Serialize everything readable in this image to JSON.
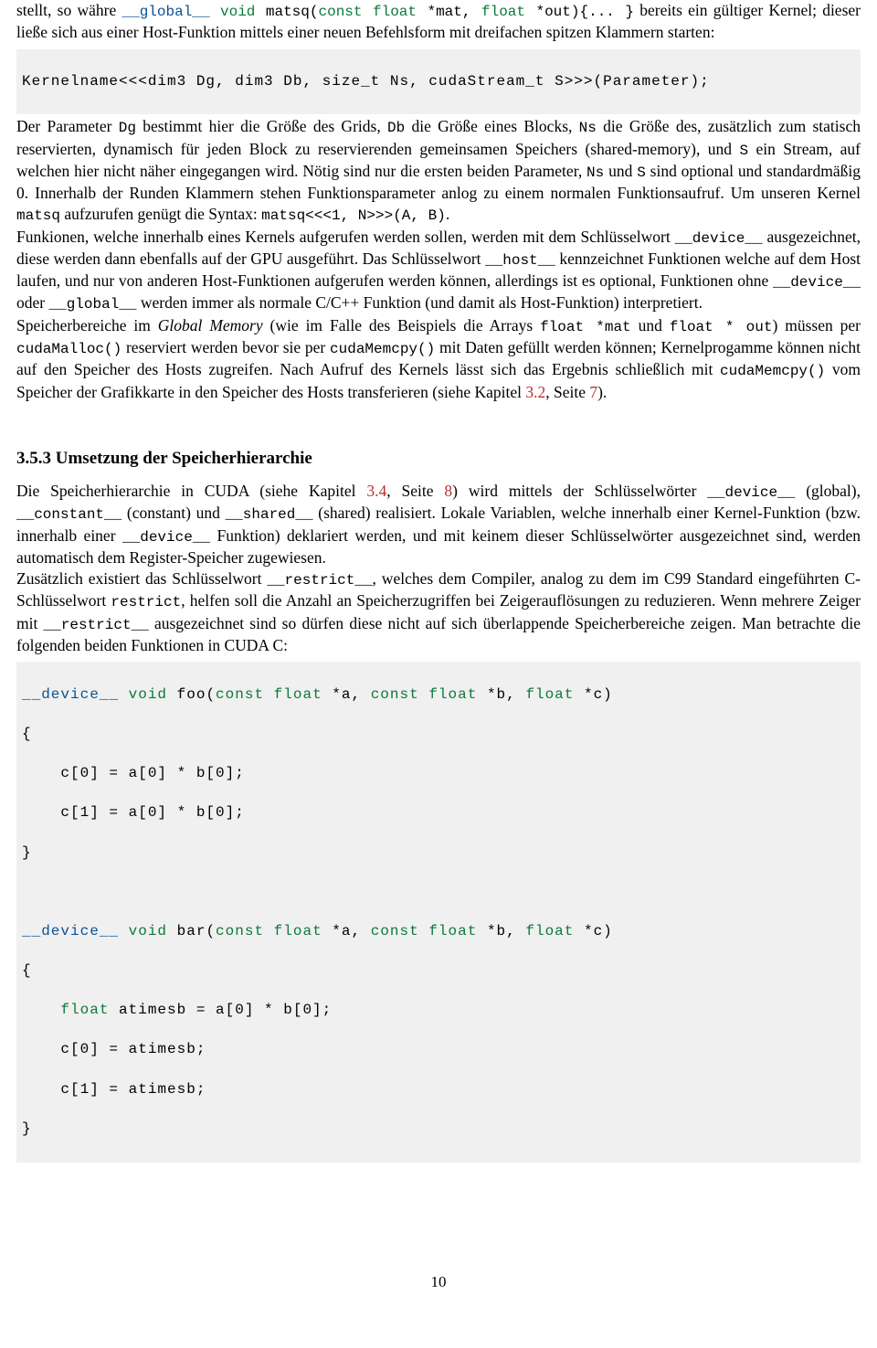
{
  "para1_lead": "stellt, so währe ",
  "para1_c1_kw": "__global__",
  "para1_c1_sp": " ",
  "para1_c1_void": "void",
  "para1_c1_fn": " matsq(",
  "para1_c1_const": "const",
  "para1_c1_sp2": " ",
  "para1_c1_float1": "float",
  "para1_c1_arg1": " *mat, ",
  "para1_c1_float2": "float",
  "para1_c1_arg2": " *out){... }",
  "para1_cont": " bereits ein gültiger Kernel; dieser ließe sich aus einer Host-Funktion mittels einer neuen Befehlsform mit dreifachen spitzen Klammern starten:",
  "code1": "Kernelname<<<dim3 Dg, dim3 Db, size_t Ns, cudaStream_t S>>>(Parameter);",
  "para2_a": "Der Parameter ",
  "para2_Dg": "Dg",
  "para2_b": " bestimmt hier die Größe des Grids, ",
  "para2_Db": "Db",
  "para2_c": " die Größe eines Blocks, ",
  "para2_Ns": "Ns",
  "para2_d": " die Größe des, zusätzlich zum statisch reservierten, dynamisch für jeden Block zu reservierenden gemeinsamen Speichers (shared-memory), und ",
  "para2_S": "S",
  "para2_e": " ein Stream, auf welchen hier nicht näher eingegangen wird. Nötig sind nur die ersten beiden Parameter, ",
  "para2_Ns2": "Ns",
  "para2_f": " und ",
  "para2_S2": "S",
  "para2_g": " sind optional und standardmäßig 0. Innerhalb der Runden Klammern stehen Funktionsparameter anlog zu einem normalen Funktionsaufruf. Um unseren Kernel ",
  "para2_matsq": "matsq",
  "para2_h": " aufzurufen genügt die Syntax: ",
  "para2_call": "matsq<<<1, N>>>(A, B)",
  "para2_i": ".",
  "para3_a": "Funkionen, welche innerhalb eines Kernels aufgerufen werden sollen, werden mit dem Schlüsselwort ",
  "para3_dev": "__device__",
  "para3_b": " ausgezeichnet, diese werden dann ebenfalls auf der GPU ausgeführt. Das Schlüsselwort ",
  "para3_host": "__host__",
  "para3_c": " kennzeichnet Funktionen welche auf dem Host laufen, und nur von anderen Host-Funktionen aufgerufen werden können, allerdings ist es optional, Funktionen ohne ",
  "para3_dev2": "__device__",
  "para3_d": " oder ",
  "para3_glob": "__global__",
  "para3_e": " werden immer als normale C/C++ Funktion (und damit als Host-Funktion) interpretiert.",
  "para4_a": "Speicherbereiche im ",
  "para4_gm": "Global Memory",
  "para4_b": " (wie im Falle des Beispiels die Arrays ",
  "para4_f1": "float *mat",
  "para4_c": " und ",
  "para4_f2": "float * out",
  "para4_d": ") müssen per ",
  "para4_malloc": "cudaMalloc()",
  "para4_e": " reserviert werden bevor sie per ",
  "para4_memcpy": "cudaMemcpy()",
  "para4_f": " mit Daten gefüllt werden können; Kernelprogamme können nicht auf den Speicher des Hosts zugreifen. Nach Aufruf des Kernels lässt sich das Ergebnis schließlich mit ",
  "para4_memcpy2": "cudaMemcpy()",
  "para4_g": " vom Speicher der Grafikkarte in den Speicher des Hosts transferieren (siehe Kapitel ",
  "para4_ref1": "3.2",
  "para4_h": ", Seite ",
  "para4_ref2": "7",
  "para4_i": ").",
  "heading": "3.5.3   Umsetzung der Speicherhierarchie",
  "para5_a": "Die Speicherhierarchie in CUDA (siehe Kapitel ",
  "para5_ref1": "3.4",
  "para5_b": ", Seite ",
  "para5_ref2": "8",
  "para5_c": ") wird mittels der Schlüsselwörter ",
  "para5_dev": "__device__",
  "para5_d": " (global), ",
  "para5_const": "__constant__",
  "para5_e": " (constant) und ",
  "para5_shared": "__shared__",
  "para5_f": " (shared) realisiert. Lokale Variablen, welche innerhalb einer Kernel-Funktion (bzw. innerhalb einer ",
  "para5_dev2": "__device__",
  "para5_g": " Funktion) deklariert werden, und mit keinem dieser Schlüsselwörter ausgezeichnet sind, werden automatisch dem Register-Speicher zugewiesen.",
  "para6_a": "Zusätzlich existiert das Schlüsselwort ",
  "para6_restr": "__restrict__",
  "para6_b": ", welches dem Compiler, analog zu dem im C99 Standard eingeführten C-Schlüsselwort ",
  "para6_restr2": "restrict",
  "para6_c": ", helfen soll die Anzahl an Speicherzugriffen bei Zeigerauflösungen zu reduzieren. Wenn mehrere Zeiger mit ",
  "para6_restr3": "__restrict__",
  "para6_d": " ausgezeichnet sind so dürfen diese nicht auf sich überlappende Speicherbereiche zeigen. Man betrachte die folgenden beiden Funktionen in CUDA C:",
  "code2": {
    "l1_dev": "__device__",
    "l1_void": "void",
    "l1_fn": " foo(",
    "l1_const1": "const",
    "l1_sp1": " ",
    "l1_float1": "float",
    "l1_arg1": " *a, ",
    "l1_const2": "const",
    "l1_sp2": " ",
    "l1_float2": "float",
    "l1_arg2": " *b, ",
    "l1_float3": "float",
    "l1_arg3": " *c)",
    "l2": "{",
    "l3": "    c[0] = a[0] * b[0];",
    "l4": "    c[1] = a[0] * b[0];",
    "l5": "}",
    "l7_dev": "__device__",
    "l7_void": "void",
    "l7_fn": " bar(",
    "l7_const1": "const",
    "l7_sp1": " ",
    "l7_float1": "float",
    "l7_arg1": " *a, ",
    "l7_const2": "const",
    "l7_sp2": " ",
    "l7_float2": "float",
    "l7_arg2": " *b, ",
    "l7_float3": "float",
    "l7_arg3": " *c)",
    "l8": "{",
    "l9_float": "float",
    "l9_rest": " atimesb = a[0] * b[0];",
    "l10": "    c[0] = atimesb;",
    "l11": "    c[1] = atimesb;",
    "l12": "}"
  },
  "pagenum": "10"
}
